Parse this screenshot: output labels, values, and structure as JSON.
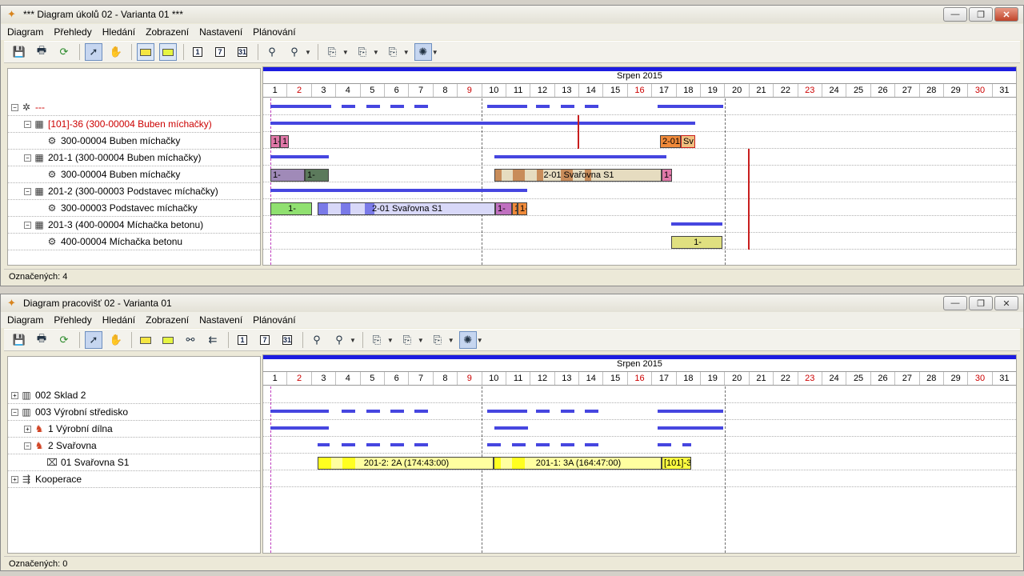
{
  "top": {
    "title": "*** Diagram úkolů   02 - Varianta 01 ***",
    "menu": [
      "Diagram",
      "Přehledy",
      "Hledání",
      "Zobrazení",
      "Nastavení",
      "Plánování"
    ],
    "tree": [
      {
        "label": "---",
        "level": 0,
        "red": true
      },
      {
        "label": "[101]-36  (300-00004 Buben míchačky)",
        "level": 1,
        "red": true
      },
      {
        "label": "300-00004 Buben míchačky",
        "level": 2,
        "red": false
      },
      {
        "label": "201-1  (300-00004 Buben míchačky)",
        "level": 1,
        "red": false
      },
      {
        "label": "300-00004 Buben míchačky",
        "level": 2,
        "red": false
      },
      {
        "label": "201-2  (300-00003 Podstavec míchačky)",
        "level": 1,
        "red": false
      },
      {
        "label": "300-00003 Podstavec míchačky",
        "level": 2,
        "red": false
      },
      {
        "label": "201-3  (400-00004 Míchačka betonu)",
        "level": 1,
        "red": false
      },
      {
        "label": "400-00004 Míchačka betonu",
        "level": 2,
        "red": false
      }
    ],
    "bar_labels": {
      "b1": "1-",
      "b2": "1",
      "b3": "2-01",
      "b4": "Sv",
      "b5": "1-",
      "b6": "1-",
      "b7": "2-01 Svařovna S1",
      "b8": "1-",
      "b9": "1-",
      "b10": "2-01 Svařovna S1",
      "b11": "1-",
      "b12": "1",
      "b13": "1-",
      "b14": "1-"
    },
    "status": "Označených: 4"
  },
  "bottom": {
    "title": "Diagram pracovišť   02 - Varianta 01",
    "menu": [
      "Diagram",
      "Přehledy",
      "Hledání",
      "Zobrazení",
      "Nastavení",
      "Plánování"
    ],
    "tree": [
      {
        "label": "002 Sklad 2",
        "level": 0,
        "expanded": false
      },
      {
        "label": "003 Výrobní středisko",
        "level": 0,
        "expanded": true
      },
      {
        "label": "1 Výrobní dílna",
        "level": 1,
        "expanded": false
      },
      {
        "label": "2 Svařovna",
        "level": 1,
        "expanded": true
      },
      {
        "label": "01 Svařovna S1",
        "level": 2,
        "expanded": null
      },
      {
        "label": "Kooperace",
        "level": 0,
        "expanded": false
      }
    ],
    "bar_labels": {
      "b1": "201-2: 2A (174:43:00)",
      "b2": "201-1: 3A (164:47:00)",
      "b3": "[101]-3"
    },
    "status": "Označených: 0"
  },
  "month_label": "Srpen 2015",
  "days": [
    "1",
    "2",
    "3",
    "4",
    "5",
    "6",
    "7",
    "8",
    "9",
    "10",
    "11",
    "12",
    "13",
    "14",
    "15",
    "16",
    "17",
    "18",
    "19",
    "20",
    "21",
    "22",
    "23",
    "24",
    "25",
    "26",
    "27",
    "28",
    "29",
    "30",
    "31"
  ],
  "weekend_days": [
    "2",
    "9",
    "16",
    "23",
    "30"
  ],
  "colors": {
    "summary_bar": "#4646e0",
    "today_line": "#c040c0",
    "deadline": "#c81e1e",
    "workplace_bar": "#ffff40"
  }
}
